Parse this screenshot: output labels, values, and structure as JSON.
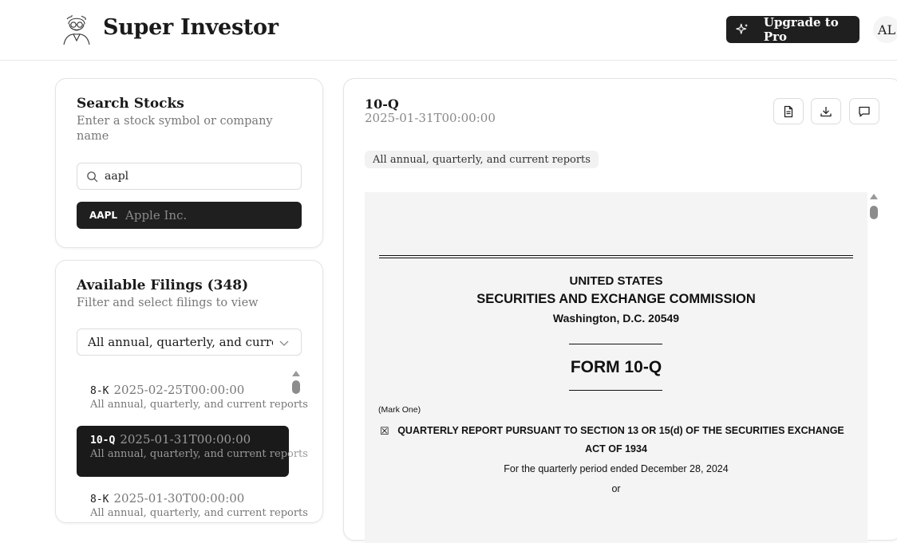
{
  "header": {
    "brand": "Super Investor",
    "upgrade_label": "Upgrade to Pro",
    "avatar_initials": "AL"
  },
  "search": {
    "title": "Search Stocks",
    "subtitle": "Enter a stock symbol or company name",
    "query": "aapl",
    "results": [
      {
        "symbol": "AAPL",
        "name": "Apple Inc."
      }
    ]
  },
  "filings": {
    "title": "Available Filings (348)",
    "subtitle": "Filter and select filings to view",
    "filter_selected": "All annual, quarterly, and curren",
    "items": [
      {
        "type": "8-K",
        "date": "2025-02-25T00:00:00",
        "description": "All annual, quarterly, and current reports",
        "active": false
      },
      {
        "type": "10-Q",
        "date": "2025-01-31T00:00:00",
        "description": "All annual, quarterly, and current reports",
        "active": true
      },
      {
        "type": "8-K",
        "date": "2025-01-30T00:00:00",
        "description": "All annual, quarterly, and current reports",
        "active": false
      }
    ]
  },
  "document": {
    "type": "10-Q",
    "date": "2025-01-31T00:00:00",
    "category": "All annual, quarterly, and current reports",
    "actions": [
      "document-icon",
      "download-icon",
      "comment-icon"
    ],
    "content": {
      "line1": "UNITED STATES",
      "line2": "SECURITIES AND EXCHANGE COMMISSION",
      "line3": "Washington, D.C. 20549",
      "form_title": "FORM 10-Q",
      "mark_one": "(Mark One)",
      "checkbox_glyph": "☒",
      "report_line1": "QUARTERLY REPORT PURSUANT TO SECTION 13 OR 15(d) OF THE SECURITIES EXCHANGE",
      "report_line2": "ACT OF 1934",
      "period": "For the quarterly period ended December 28, 2024",
      "or": "or"
    }
  },
  "colors": {
    "dark": "#1f1f1f",
    "muted_text": "#777777",
    "viewer_bg": "#f4f4f4"
  }
}
